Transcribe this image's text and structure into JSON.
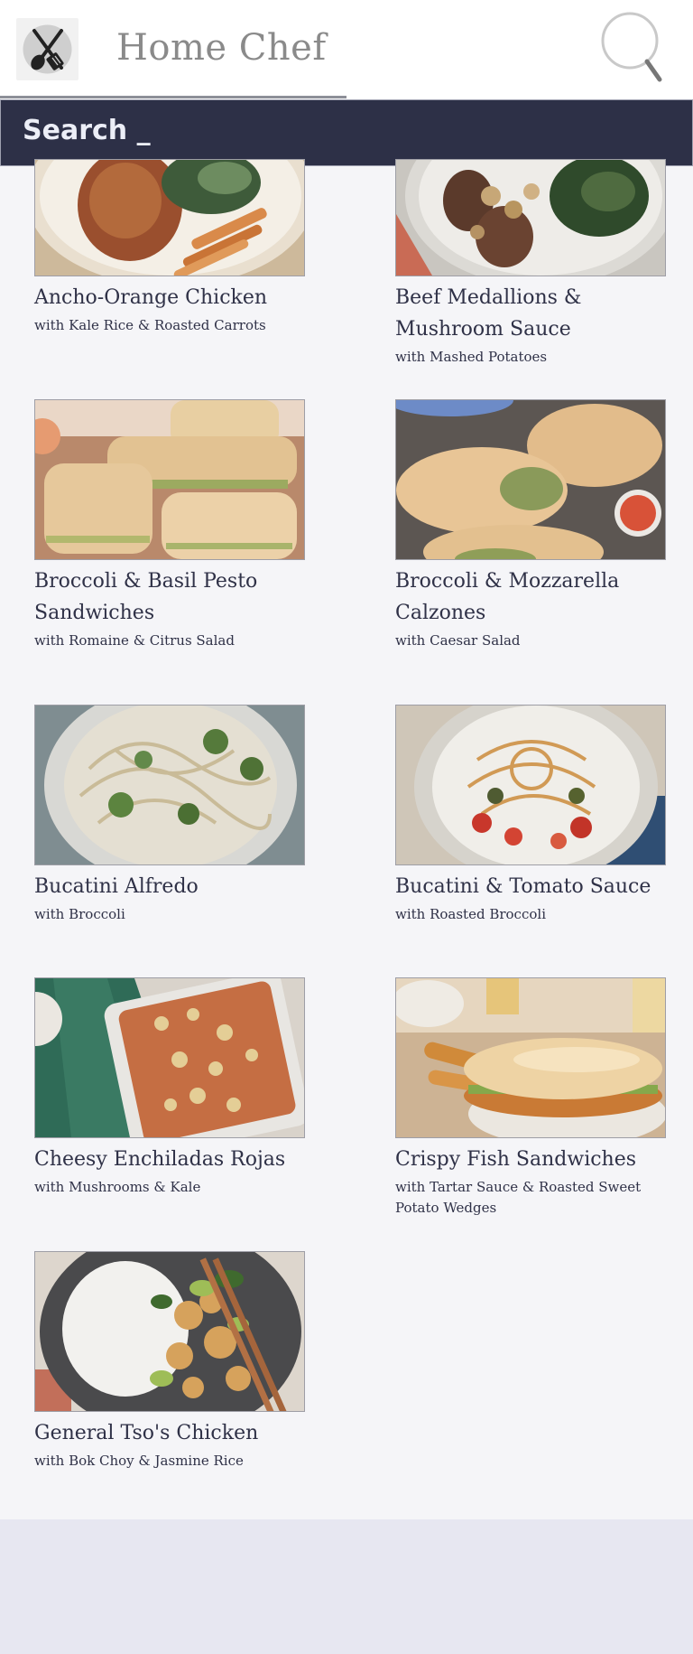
{
  "header": {
    "app_title": "Home Chef",
    "logo_icon": "utensils-logo-icon",
    "search_icon": "magnifier-icon"
  },
  "search_bar": {
    "label": "Search _"
  },
  "colors": {
    "header_bg": "#ffffff",
    "search_bar_bg": "#2d3047",
    "search_text": "#eceef7",
    "content_bg": "#f5f5f8",
    "page_bg": "#e7e7f1",
    "text_primary": "#2f3147"
  },
  "meals": [
    {
      "name": "Ancho-Orange Chicken",
      "subtitle": "with Kale Rice & Roasted Carrots"
    },
    {
      "name": "Beef Medallions & Mushroom Sauce",
      "subtitle": "with Mashed Potatoes"
    },
    {
      "name": "Broccoli & Basil Pesto Sandwiches",
      "subtitle": "with Romaine & Citrus Salad"
    },
    {
      "name": "Broccoli & Mozzarella Calzones",
      "subtitle": "with Caesar Salad"
    },
    {
      "name": "Bucatini Alfredo",
      "subtitle": "with Broccoli"
    },
    {
      "name": "Bucatini & Tomato Sauce",
      "subtitle": "with Roasted Broccoli"
    },
    {
      "name": "Cheesy Enchiladas Rojas",
      "subtitle": "with Mushrooms & Kale"
    },
    {
      "name": "Crispy Fish Sandwiches",
      "subtitle": "with Tartar Sauce & Roasted Sweet Potato Wedges"
    },
    {
      "name": "General Tso's Chicken",
      "subtitle": "with Bok Choy & Jasmine Rice"
    }
  ]
}
